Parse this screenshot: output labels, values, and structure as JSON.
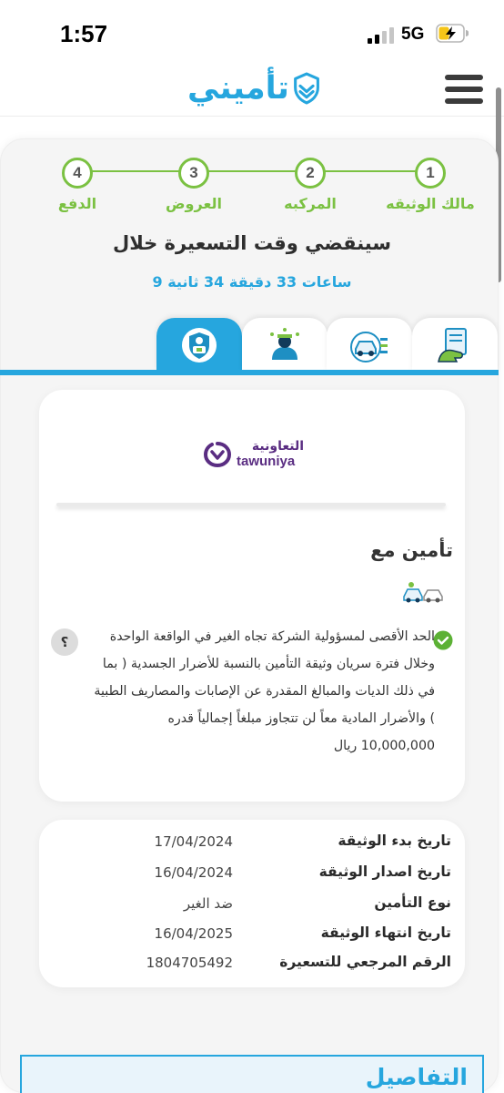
{
  "status_bar": {
    "time": "1:57",
    "network": "5G"
  },
  "header": {
    "logo_text": "تأميني"
  },
  "stepper": {
    "steps": [
      {
        "number": "1",
        "label": "مالك الوثيقه"
      },
      {
        "number": "2",
        "label": "المركبه"
      },
      {
        "number": "3",
        "label": "العروض"
      },
      {
        "number": "4",
        "label": "الدفع"
      }
    ]
  },
  "countdown": {
    "title": "سينقضي وقت التسعيرة خلال",
    "value": "9 ساعات 33 دقيقة 34 ثانية"
  },
  "tabs": {
    "items": [
      {
        "icon": "shield-person-icon",
        "active": true
      },
      {
        "icon": "mechanic-icon",
        "active": false
      },
      {
        "icon": "car-accident-icon",
        "active": false
      },
      {
        "icon": "hand-document-icon",
        "active": false
      }
    ]
  },
  "offer": {
    "company_name_ar": "التعاونية",
    "company_name_en": "tawuniya",
    "insured_with": "تأمين مع",
    "coverage_text": "الحد الأقصى لمسؤولية الشركة تجاه الغير في الواقعة الواحدة وخلال فترة سريان وثيقة التأمين بالنسبة للأضرار الجسدية ( بما في ذلك الديات والمبالغ المقدرة عن الإصابات والمصاريف الطبية ) والأضرار المادية معاً لن تتجاوز مبلغاً إجمالياً قدره 10,000,000 ريال",
    "help_label": "؟"
  },
  "policy_details": [
    {
      "label": "تاريخ بدء الوثيقة",
      "value": "17/04/2024"
    },
    {
      "label": "تاريخ اصدار الوثيقة",
      "value": "16/04/2024"
    },
    {
      "label": "نوع التأمين",
      "value": "ضد الغير"
    },
    {
      "label": "تاريخ انتهاء الوثيقة",
      "value": "16/04/2025"
    },
    {
      "label": "الرقم المرجعي للتسعيرة",
      "value": "1804705492"
    }
  ],
  "details_section": {
    "title": "التفاصيل"
  },
  "colors": {
    "primary": "#26a6de",
    "step_green": "#7bc142",
    "check_green": "#5cb135",
    "brand_purple": "#5a2d82"
  }
}
